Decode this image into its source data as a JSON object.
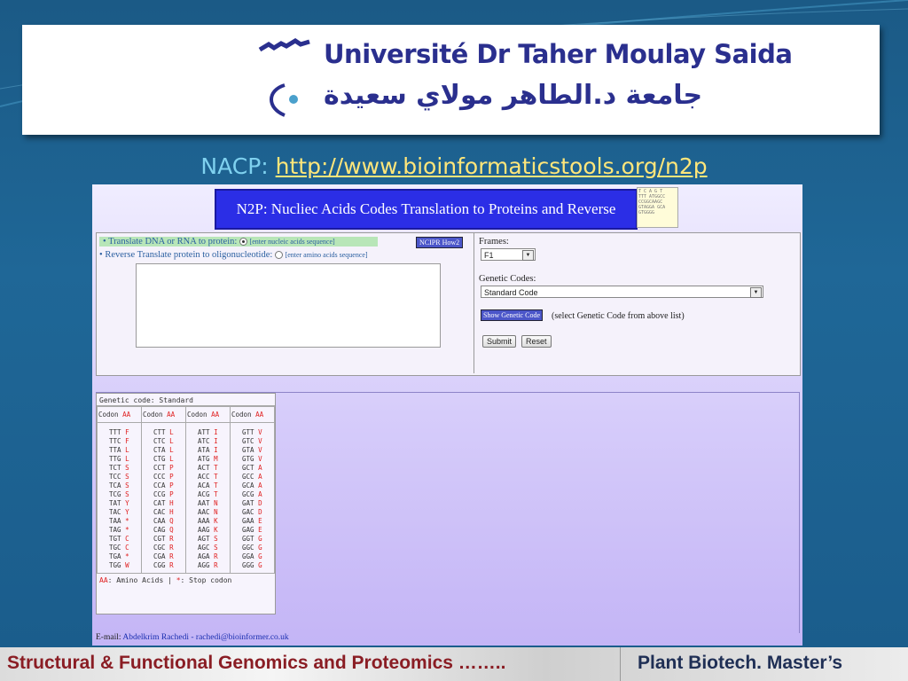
{
  "slide": {
    "logo": {
      "name_fr": "Université Dr Taher Moulay Saida",
      "name_ar": "جامعة د.الطاهر مولاي سعيدة"
    },
    "heading": {
      "prefix": "NACP: ",
      "link": "http://www.bioinformaticstools.org/n2p"
    },
    "footer": {
      "left": "Structural & Functional Genomics and Proteomics ……..",
      "right": "Plant Biotech. Master’s"
    }
  },
  "tool": {
    "banner": "N2P: Nucliec Acids Codes Translation to Proteins and Reverse",
    "options": {
      "translate_label": "Translate DNA or RNA to protein:",
      "translate_hint": "[enter nucleic acids sequence]",
      "reverse_label": "Reverse Translate protein to oligonucleotide:",
      "reverse_hint": "[enter amino acids sequence]",
      "howto_button": "NCIPR How2"
    },
    "sequence_input": "",
    "frames": {
      "label": "Frames:",
      "selected": "F1"
    },
    "genetic_codes": {
      "label": "Genetic Codes:",
      "selected": "Standard Code"
    },
    "show_genetic_code_button": "Show Genetic Code",
    "show_genetic_code_hint": "(select Genetic Code from above list)",
    "submit": "Submit",
    "reset": "Reset",
    "codon_table": {
      "title": "Genetic code: Standard",
      "header": [
        "Codon",
        "AA"
      ],
      "columns": [
        [
          [
            "TTT",
            "F"
          ],
          [
            "TTC",
            "F"
          ],
          [
            "TTA",
            "L"
          ],
          [
            "TTG",
            "L"
          ],
          [
            "TCT",
            "S"
          ],
          [
            "TCC",
            "S"
          ],
          [
            "TCA",
            "S"
          ],
          [
            "TCG",
            "S"
          ],
          [
            "TAT",
            "Y"
          ],
          [
            "TAC",
            "Y"
          ],
          [
            "TAA",
            "*"
          ],
          [
            "TAG",
            "*"
          ],
          [
            "TGT",
            "C"
          ],
          [
            "TGC",
            "C"
          ],
          [
            "TGA",
            "*"
          ],
          [
            "TGG",
            "W"
          ]
        ],
        [
          [
            "CTT",
            "L"
          ],
          [
            "CTC",
            "L"
          ],
          [
            "CTA",
            "L"
          ],
          [
            "CTG",
            "L"
          ],
          [
            "CCT",
            "P"
          ],
          [
            "CCC",
            "P"
          ],
          [
            "CCA",
            "P"
          ],
          [
            "CCG",
            "P"
          ],
          [
            "CAT",
            "H"
          ],
          [
            "CAC",
            "H"
          ],
          [
            "CAA",
            "Q"
          ],
          [
            "CAG",
            "Q"
          ],
          [
            "CGT",
            "R"
          ],
          [
            "CGC",
            "R"
          ],
          [
            "CGA",
            "R"
          ],
          [
            "CGG",
            "R"
          ]
        ],
        [
          [
            "ATT",
            "I"
          ],
          [
            "ATC",
            "I"
          ],
          [
            "ATA",
            "I"
          ],
          [
            "ATG",
            "M"
          ],
          [
            "ACT",
            "T"
          ],
          [
            "ACC",
            "T"
          ],
          [
            "ACA",
            "T"
          ],
          [
            "ACG",
            "T"
          ],
          [
            "AAT",
            "N"
          ],
          [
            "AAC",
            "N"
          ],
          [
            "AAA",
            "K"
          ],
          [
            "AAG",
            "K"
          ],
          [
            "AGT",
            "S"
          ],
          [
            "AGC",
            "S"
          ],
          [
            "AGA",
            "R"
          ],
          [
            "AGG",
            "R"
          ]
        ],
        [
          [
            "GTT",
            "V"
          ],
          [
            "GTC",
            "V"
          ],
          [
            "GTA",
            "V"
          ],
          [
            "GTG",
            "V"
          ],
          [
            "GCT",
            "A"
          ],
          [
            "GCC",
            "A"
          ],
          [
            "GCA",
            "A"
          ],
          [
            "GCG",
            "A"
          ],
          [
            "GAT",
            "D"
          ],
          [
            "GAC",
            "D"
          ],
          [
            "GAA",
            "E"
          ],
          [
            "GAG",
            "E"
          ],
          [
            "GGT",
            "G"
          ],
          [
            "GGC",
            "G"
          ],
          [
            "GGA",
            "G"
          ],
          [
            "GGG",
            "G"
          ]
        ]
      ],
      "legend_aa": "AA",
      "legend_aa_text": ": Amino Acids | ",
      "legend_stop": "*",
      "legend_stop_text": ": Stop codon"
    },
    "email_label": "E-mail: ",
    "email_link": "Abdelkrim Rachedi - rachedi@bioinformer.co.uk"
  },
  "colors": {
    "slide_bg": "#1f6797",
    "banner_bg": "#2b2ee6",
    "amino_acid": "#e02020",
    "footer_left": "#8a1d24",
    "footer_right": "#1f2f55"
  }
}
